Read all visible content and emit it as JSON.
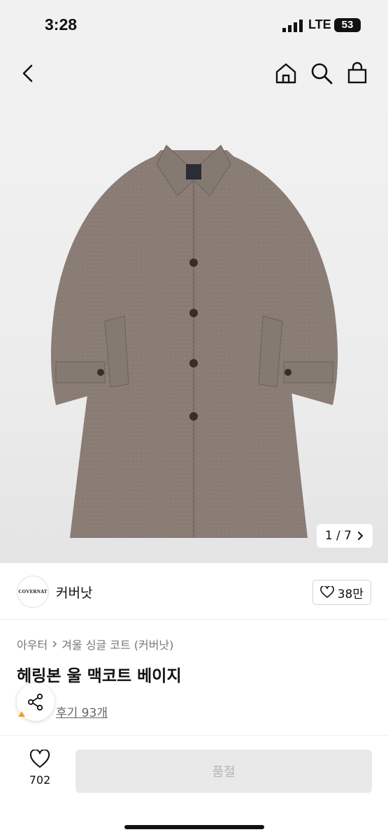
{
  "status_bar": {
    "time": "3:28",
    "network": "LTE",
    "battery": "53"
  },
  "nav": {
    "icons": [
      "back-icon",
      "home-icon",
      "search-icon",
      "shopping-bag-icon"
    ]
  },
  "gallery": {
    "counter": "1 / 7"
  },
  "brand": {
    "logo_text": "COVERNAT",
    "name": "커버낫",
    "likes": "38만"
  },
  "product": {
    "breadcrumb": [
      "아우터",
      "겨울 싱글 코트 (커버낫)"
    ],
    "title": "헤링본 울 맥코트 베이지",
    "reviews": "후기 93개"
  },
  "bottom": {
    "wish_count": "702",
    "buy_label": "품절"
  },
  "colors": {
    "accent": "#f3a31b",
    "disabled_bg": "#e9e9e9",
    "disabled_text": "#b5b5b5"
  }
}
